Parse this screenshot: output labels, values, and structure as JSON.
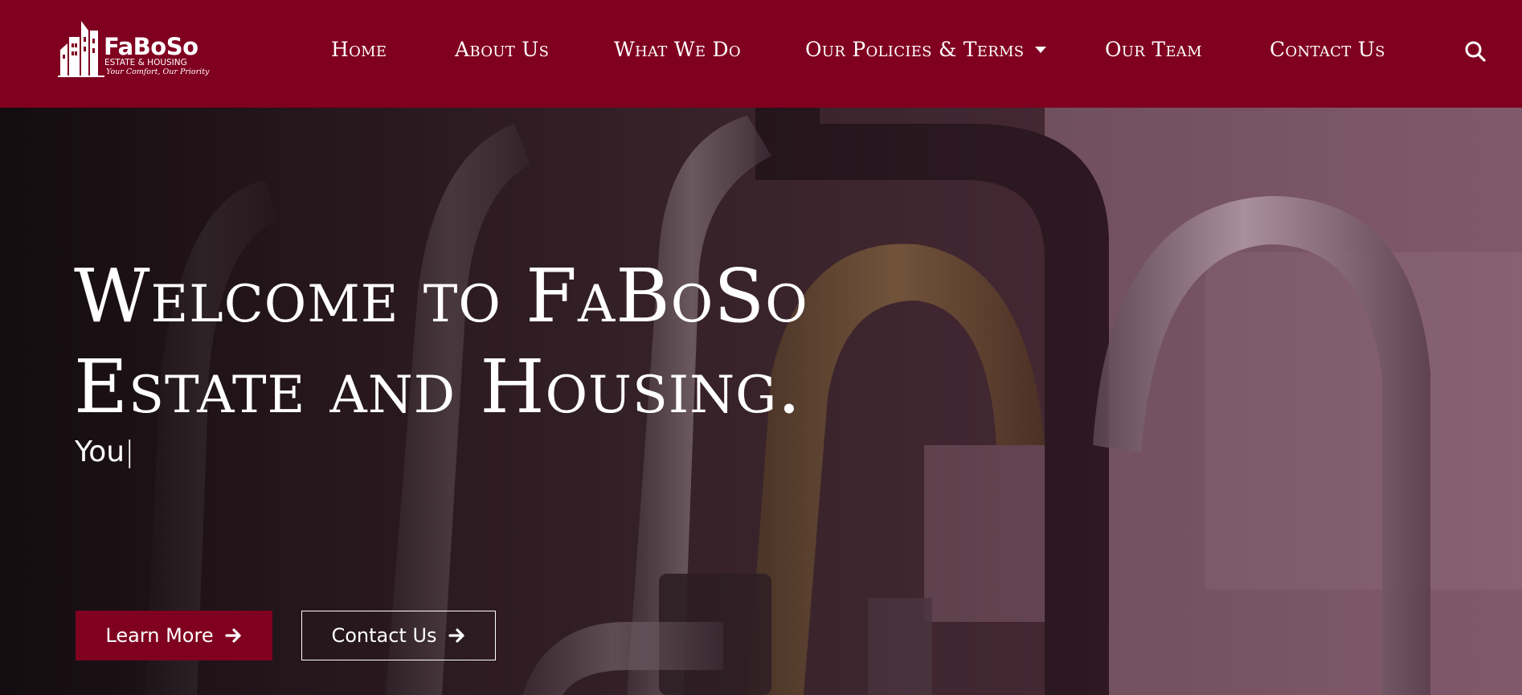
{
  "brand": {
    "name": "FaBoSo",
    "subtitle": "ESTATE & HOUSING",
    "tagline": "Your Comfort, Our Priority"
  },
  "nav": {
    "items": [
      {
        "label": "Home"
      },
      {
        "label": "About Us"
      },
      {
        "label": "What We Do"
      },
      {
        "label": "Our Policies & Terms"
      },
      {
        "label": "Our Team"
      },
      {
        "label": "Contact Us"
      }
    ],
    "search_icon": "search-icon"
  },
  "hero": {
    "title_line1": "Welcome to FaBoSo",
    "title_line2": "Estate and Housing.",
    "typed_text": "You",
    "cursor": "|",
    "primary_button": "Learn More",
    "secondary_button": "Contact Us"
  },
  "colors": {
    "brand": "#800020",
    "text": "#ffffff"
  }
}
